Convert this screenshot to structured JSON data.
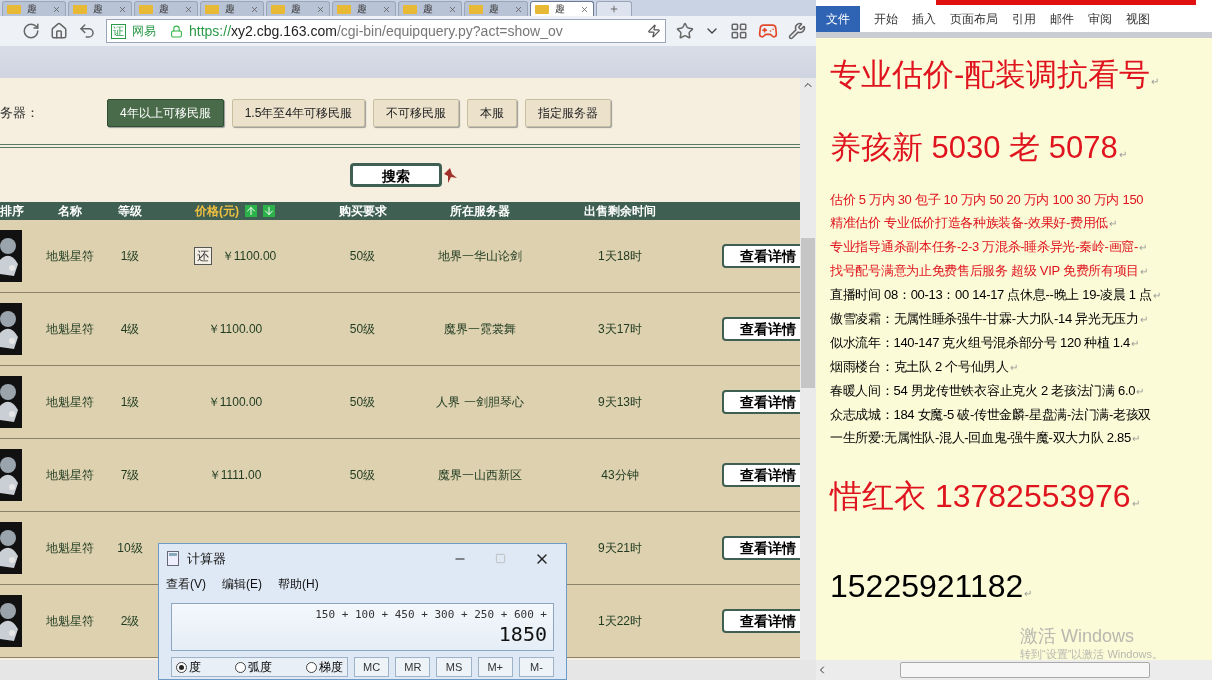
{
  "browser": {
    "tabs": [
      {
        "label": "趣",
        "selected": false
      },
      {
        "label": "趣",
        "selected": false
      },
      {
        "label": "趣",
        "selected": false
      },
      {
        "label": "趣",
        "selected": false
      },
      {
        "label": "趣",
        "selected": false
      },
      {
        "label": "趣",
        "selected": false
      },
      {
        "label": "趣",
        "selected": false
      },
      {
        "label": "趣",
        "selected": false
      },
      {
        "label": "趣",
        "selected": true
      }
    ],
    "address": {
      "badge": "证",
      "site": "网易",
      "scheme": "https://",
      "host": "xy2.cbg.163.com",
      "path": "/cgi-bin/equipquery.py?act=show_ov"
    }
  },
  "page": {
    "server_label": "务器：",
    "server_filters": [
      {
        "label": "4年以上可移民服",
        "selected": true
      },
      {
        "label": "1.5年至4年可移民服",
        "selected": false
      },
      {
        "label": "不可移民服",
        "selected": false
      },
      {
        "label": "本服",
        "selected": false
      },
      {
        "label": "指定服务器",
        "selected": false
      }
    ],
    "search_button": "搜索",
    "table": {
      "columns": [
        "排序",
        "名称",
        "等级",
        "价格(元)",
        "购买要求",
        "所在服务器",
        "出售剩余时间"
      ],
      "rows": [
        {
          "name": "地魁星符",
          "level": "1级",
          "badge": "还",
          "price": "￥1100.00",
          "requirement": "50级",
          "server": "地界一华山论剑",
          "time_left": "1天18时",
          "action": "查看详情"
        },
        {
          "name": "地魁星符",
          "level": "4级",
          "price": "￥1100.00",
          "requirement": "50级",
          "server": "魔界一霓裳舞",
          "time_left": "3天17时",
          "action": "查看详情"
        },
        {
          "name": "地魁星符",
          "level": "1级",
          "price": "￥1100.00",
          "requirement": "50级",
          "server": "人界 一剑胆琴心",
          "time_left": "9天13时",
          "action": "查看详情"
        },
        {
          "name": "地魁星符",
          "level": "7级",
          "price": "￥1111.00",
          "requirement": "50级",
          "server": "魔界一山西新区",
          "time_left": "43分钟",
          "action": "查看详情"
        },
        {
          "name": "地魁星符",
          "level": "10级",
          "time_left": "9天21时",
          "action": "查看详情"
        },
        {
          "name": "地魁星符",
          "level": "2级",
          "time_left": "1天22时",
          "action": "查看详情"
        }
      ]
    }
  },
  "calculator": {
    "title": "计算器",
    "menu": [
      "查看(V)",
      "编辑(E)",
      "帮助(H)"
    ],
    "expression": "150 + 100 + 450 + 300 + 250 + 600 +",
    "result": "1850",
    "angle_modes": [
      {
        "label": "度",
        "selected": true
      },
      {
        "label": "弧度",
        "selected": false
      },
      {
        "label": "梯度",
        "selected": false
      }
    ],
    "memory_buttons": [
      "MC",
      "MR",
      "MS",
      "M+",
      "M-"
    ]
  },
  "word": {
    "ribbon_tabs": [
      {
        "label": "文件",
        "selected": true
      },
      {
        "label": "开始",
        "selected": false
      },
      {
        "label": "插入",
        "selected": false
      },
      {
        "label": "页面布局",
        "selected": false
      },
      {
        "label": "引用",
        "selected": false
      },
      {
        "label": "邮件",
        "selected": false
      },
      {
        "label": "审阅",
        "selected": false
      },
      {
        "label": "视图",
        "selected": false
      }
    ],
    "lines": [
      {
        "kind": "headline",
        "text": "专业估价-配装调抗看号",
        "mark": "↵"
      },
      {
        "kind": "headline",
        "text": "养孩新 5030 老 5078",
        "mark": "↵"
      },
      {
        "kind": "note_red",
        "text": "估价 5 万内 30 包子  10 万内 50  20 万内 100  30 万内 150"
      },
      {
        "kind": "note_red",
        "text": "精准估价  专业低价打造各种族装备-效果好-费用低",
        "mark": "↵"
      },
      {
        "kind": "note_red",
        "text": "专业指导通杀副本任务-2-3 万混杀-睡杀异光-秦岭-画窟-",
        "mark": "↵"
      },
      {
        "kind": "note_red",
        "text": "找号配号满意为止免费售后服务  超级 VIP 免费所有项目",
        "mark": "↵"
      },
      {
        "kind": "note",
        "text": "直播时间 08：00-13：00 14-17 点休息--晚上 19-凌晨 1 点",
        "mark": "↵"
      },
      {
        "kind": "note",
        "text": "傲雪凌霜：无属性睡杀强牛-甘霖-大力队-14 异光无压力",
        "mark": "↵"
      },
      {
        "kind": "note",
        "text": "似水流年：140-147 克火组号混杀部分号 120 种植 1.4",
        "mark": "↵"
      },
      {
        "kind": "note",
        "text": "烟雨楼台：克土队 2 个号仙男人",
        "mark": "↵"
      },
      {
        "kind": "note",
        "text": "春暖人间：54 男龙传世铁衣容止克火 2 老孩法门满 6.0",
        "mark": "↵"
      },
      {
        "kind": "note",
        "text": "众志成城：184 女魔-5 破-传世金麟-星盘满-法门满-老孩双"
      },
      {
        "kind": "note",
        "text": "一生所爱:无属性队-混人-回血鬼-强牛魔-双大力队 2.85",
        "mark": "↵"
      },
      {
        "kind": "contact_red",
        "text": "惜红衣 13782553976",
        "mark": "↵"
      },
      {
        "kind": "contact",
        "text": "15225921182",
        "mark": "↵"
      }
    ]
  },
  "activation": {
    "title": "激活 Windows",
    "hint": "转到“设置”以激活 Windows。"
  }
}
